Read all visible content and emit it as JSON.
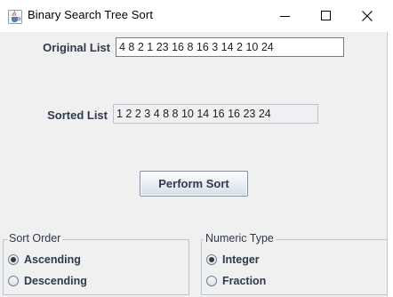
{
  "window": {
    "title": "Binary Search Tree Sort",
    "app_icon": "java-coffee-cup-icon",
    "controls": [
      "minimize-icon",
      "maximize-icon",
      "close-icon"
    ]
  },
  "original": {
    "label": "Original List",
    "value": "4 8 2 1 23 16 8 16 3 14 2 10 24"
  },
  "sorted": {
    "label": "Sorted List",
    "value": "1 2 2 3 4 8 8 10 14 16 16 23 24"
  },
  "actions": {
    "perform_sort": "Perform Sort"
  },
  "sort_order": {
    "title": "Sort Order",
    "options": [
      {
        "label": "Ascending",
        "checked": true
      },
      {
        "label": "Descending",
        "checked": false
      }
    ]
  },
  "numeric_type": {
    "title": "Numeric Type",
    "options": [
      {
        "label": "Integer",
        "checked": true
      },
      {
        "label": "Fraction",
        "checked": false
      }
    ]
  }
}
